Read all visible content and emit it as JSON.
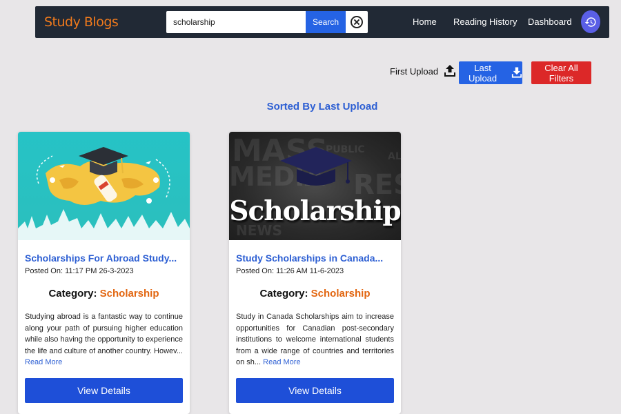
{
  "navbar": {
    "brand": "Study Blogs",
    "search_value": "scholarship",
    "search_button": "Search",
    "links": [
      "Home",
      "Reading History",
      "Dashboard"
    ],
    "icons": {
      "clear": "close-circle-icon",
      "history": "history-icon"
    }
  },
  "filters": {
    "first_upload": "First Upload",
    "last_upload": "Last Upload",
    "clear_all": "Clear All Filters"
  },
  "sort_heading": "Sorted By Last Upload",
  "cards": [
    {
      "title": "Scholarships For Abroad Study...",
      "date": "Posted On: 11:17 PM 26-3-2023",
      "category_label": "Category:",
      "category": "Scholarship",
      "description": "Studying abroad is a fantastic way to continue along your path of pursuing higher education while also having the opportunity to experience the life and culture of another country. Howev...",
      "read_more": "Read More",
      "button": "View Details"
    },
    {
      "title": "Study Scholarships in Canada...",
      "date": "Posted On: 11:26 AM 11-6-2023",
      "category_label": "Category:",
      "category": "Scholarship",
      "description": "Study in Canada Scholarships aim to increase opportunities for Canadian post-secondary institutions to welcome international students from a wide range of countries and territories on sh...",
      "read_more": "Read More",
      "button": "View Details",
      "image_text": "Scholarship"
    }
  ],
  "colors": {
    "navbar_bg": "#212935",
    "brand": "#f07a1c",
    "primary": "#2563e4",
    "danger": "#dc2828",
    "category": "#e2650f",
    "heading": "#2d5fd3"
  }
}
